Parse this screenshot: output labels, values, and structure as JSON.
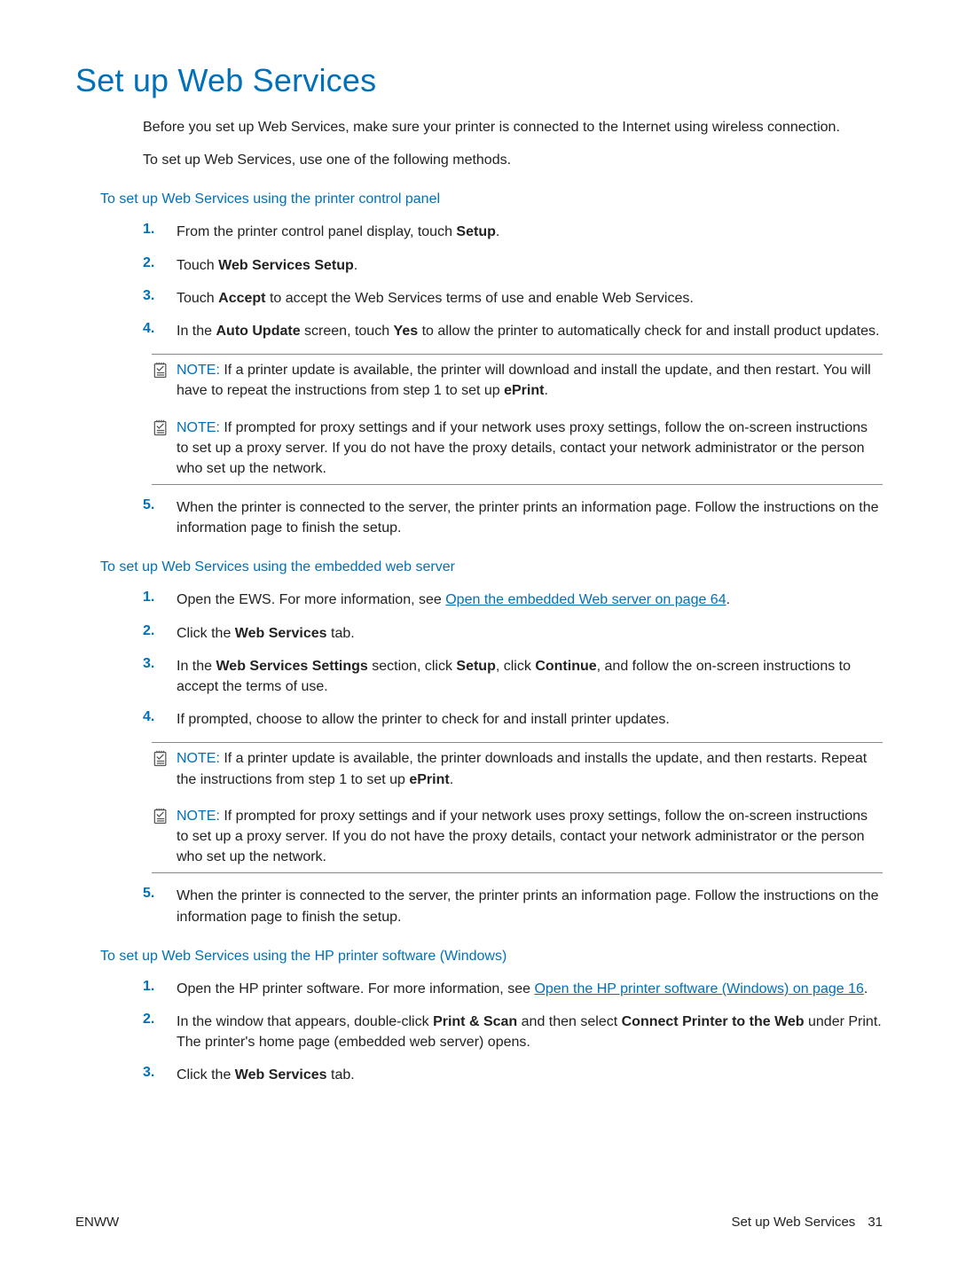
{
  "title": "Set up Web Services",
  "intro1": "Before you set up Web Services, make sure your printer is connected to the Internet using wireless connection.",
  "intro2": "To set up Web Services, use one of the following methods.",
  "section1": {
    "heading": "To set up Web Services using the printer control panel",
    "steps": {
      "s1": {
        "num": "1.",
        "pre": "From the printer control panel display, touch ",
        "b1": "Setup",
        "post": "."
      },
      "s2": {
        "num": "2.",
        "pre": "Touch ",
        "b1": "Web Services Setup",
        "post": "."
      },
      "s3": {
        "num": "3.",
        "pre": "Touch ",
        "b1": "Accept",
        "post": " to accept the Web Services terms of use and enable Web Services."
      },
      "s4": {
        "num": "4.",
        "pre": "In the ",
        "b1": "Auto Update",
        "mid": " screen, touch ",
        "b2": "Yes",
        "post": " to allow the printer to automatically check for and install product updates."
      },
      "s5": {
        "num": "5.",
        "text": "When the printer is connected to the server, the printer prints an information page. Follow the instructions on the information page to finish the setup."
      }
    },
    "note1": {
      "label": "NOTE:",
      "pre": "   If a printer update is available, the printer will download and install the update, and then restart. You will have to repeat the instructions from step 1 to set up ",
      "b1": "ePrint",
      "post": "."
    },
    "note2": {
      "label": "NOTE:",
      "text": "   If prompted for proxy settings and if your network uses proxy settings, follow the on-screen instructions to set up a proxy server. If you do not have the proxy details, contact your network administrator or the person who set up the network."
    }
  },
  "section2": {
    "heading": "To set up Web Services using the embedded web server",
    "steps": {
      "s1": {
        "num": "1.",
        "pre": "Open the EWS. For more information, see ",
        "link": "Open the embedded Web server on page 64",
        "post": "."
      },
      "s2": {
        "num": "2.",
        "pre": "Click the ",
        "b1": "Web Services",
        "post": " tab."
      },
      "s3": {
        "num": "3.",
        "pre": "In the ",
        "b1": "Web Services Settings",
        "mid1": " section, click ",
        "b2": "Setup",
        "mid2": ", click ",
        "b3": "Continue",
        "post": ", and follow the on-screen instructions to accept the terms of use."
      },
      "s4": {
        "num": "4.",
        "text": "If prompted, choose to allow the printer to check for and install printer updates."
      },
      "s5": {
        "num": "5.",
        "text": "When the printer is connected to the server, the printer prints an information page. Follow the instructions on the information page to finish the setup."
      }
    },
    "note1": {
      "label": "NOTE:",
      "pre": "   If a printer update is available, the printer downloads and installs the update, and then restarts. Repeat the instructions from step 1 to set up ",
      "b1": "ePrint",
      "post": "."
    },
    "note2": {
      "label": "NOTE:",
      "text": "   If prompted for proxy settings and if your network uses proxy settings, follow the on-screen instructions to set up a proxy server. If you do not have the proxy details, contact your network administrator or the person who set up the network."
    }
  },
  "section3": {
    "heading": "To set up Web Services using the HP printer software (Windows)",
    "steps": {
      "s1": {
        "num": "1.",
        "pre": "Open the HP printer software. For more information, see ",
        "link": "Open the HP printer software (Windows) on page 16",
        "post": "."
      },
      "s2": {
        "num": "2.",
        "pre": "In the window that appears, double-click ",
        "b1": "Print & Scan",
        "mid": " and then select ",
        "b2": "Connect Printer to the Web",
        "post": " under Print. The printer's home page (embedded web server) opens."
      },
      "s3": {
        "num": "3.",
        "pre": "Click the ",
        "b1": "Web Services",
        "post": " tab."
      }
    }
  },
  "footer": {
    "left": "ENWW",
    "right_label": "Set up Web Services",
    "page": "31"
  }
}
